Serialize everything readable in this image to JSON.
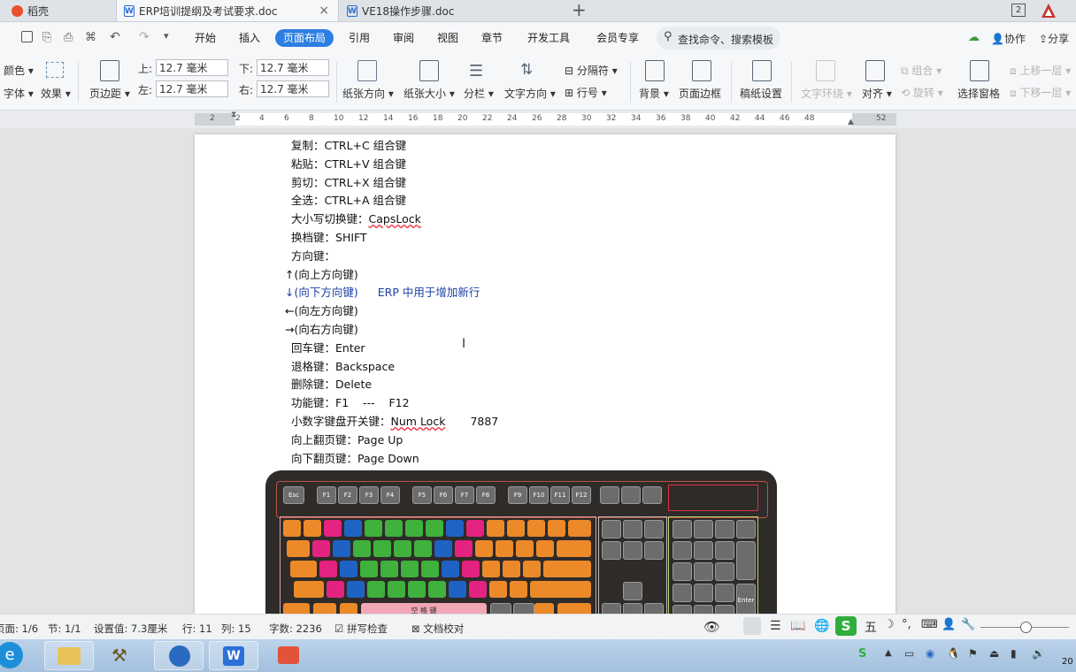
{
  "tabs": [
    {
      "label": "稻壳"
    },
    {
      "label": "ERP培训提纲及考试要求.doc"
    },
    {
      "label": "VE18操作步骤.doc"
    }
  ],
  "tab_counter": "2",
  "menu": {
    "items": [
      "开始",
      "插入",
      "页面布局",
      "引用",
      "审阅",
      "视图",
      "章节",
      "开发工具",
      "会员专享"
    ],
    "search_placeholder": "查找命令、搜索模板",
    "collab": "协作",
    "share": "分享"
  },
  "ribbon": {
    "color": "颜色",
    "font": "字体",
    "effect": "效果",
    "margins": "页边距",
    "top_label": "上:",
    "top_value": "12.7 毫米",
    "bottom_label": "下:",
    "bottom_value": "12.7 毫米",
    "left_label": "左:",
    "left_value": "12.7 毫米",
    "right_label": "右:",
    "right_value": "12.7 毫米",
    "orientation": "纸张方向",
    "size": "纸张大小",
    "columns": "分栏",
    "text_direction": "文字方向",
    "separator": "分隔符",
    "line_number": "行号",
    "background": "背景",
    "page_border": "页面边框",
    "paper_settings": "稿纸设置",
    "text_wrap": "文字环绕",
    "align": "对齐",
    "group": "组合",
    "rotate": "旋转",
    "selection_pane": "选择窗格",
    "bring_forward": "上移一层",
    "send_backward": "下移一层"
  },
  "ruler": [
    "2",
    "2",
    "4",
    "6",
    "8",
    "10",
    "12",
    "14",
    "16",
    "18",
    "20",
    "22",
    "24",
    "26",
    "28",
    "30",
    "32",
    "34",
    "36",
    "38",
    "40",
    "42",
    "44",
    "46",
    "48",
    "52"
  ],
  "document": {
    "lines": [
      {
        "label": "复制：",
        "value": "CTRL+C 组合键"
      },
      {
        "label": "粘贴：",
        "value": "CTRL+V 组合键"
      },
      {
        "label": "剪切：",
        "value": "CTRL+X 组合键"
      },
      {
        "label": "全选：",
        "value": "CTRL+A 组合键"
      },
      {
        "label": "大小写切换键：",
        "value": "CapsLock"
      },
      {
        "label": "换档键：",
        "value": "SHIFT"
      },
      {
        "label": "方向键：",
        "value": ""
      },
      {
        "label": "↑(向上方向键)",
        "value": ""
      },
      {
        "label": "↓(向下方向键)",
        "value": "ERP 中用于增加新行"
      },
      {
        "label": "←(向左方向键)",
        "value": ""
      },
      {
        "label": "→(向右方向键)",
        "value": ""
      },
      {
        "label": "回车键：",
        "value": "Enter"
      },
      {
        "label": "退格键：",
        "value": "Backspace"
      },
      {
        "label": "删除键：",
        "value": "Delete"
      },
      {
        "label": "功能键：",
        "value": "F1    ---    F12"
      },
      {
        "label": "小数字键盘开关键：",
        "value": "Num Lock",
        "extra": "7887"
      },
      {
        "label": "向上翻页键：",
        "value": "Page Up"
      },
      {
        "label": "向下翻页键：",
        "value": "Page Down"
      }
    ],
    "keyboard": {
      "esc": "Esc",
      "fkeys": [
        "F1",
        "F2",
        "F3",
        "F4",
        "F5",
        "F6",
        "F7",
        "F8",
        "F9",
        "F10",
        "F11",
        "F12"
      ],
      "space": "空 格 键",
      "enter": "Enter"
    }
  },
  "status": {
    "page": "页面: 1/6",
    "section": "节: 1/1",
    "setting": "设置值: 7.3厘米",
    "row": "行: 11",
    "col": "列: 15",
    "words": "字数: 2236",
    "spell": "拼写检查",
    "proof": "文档校对"
  },
  "taskbar": {
    "ime": "五",
    "clock": "20"
  }
}
